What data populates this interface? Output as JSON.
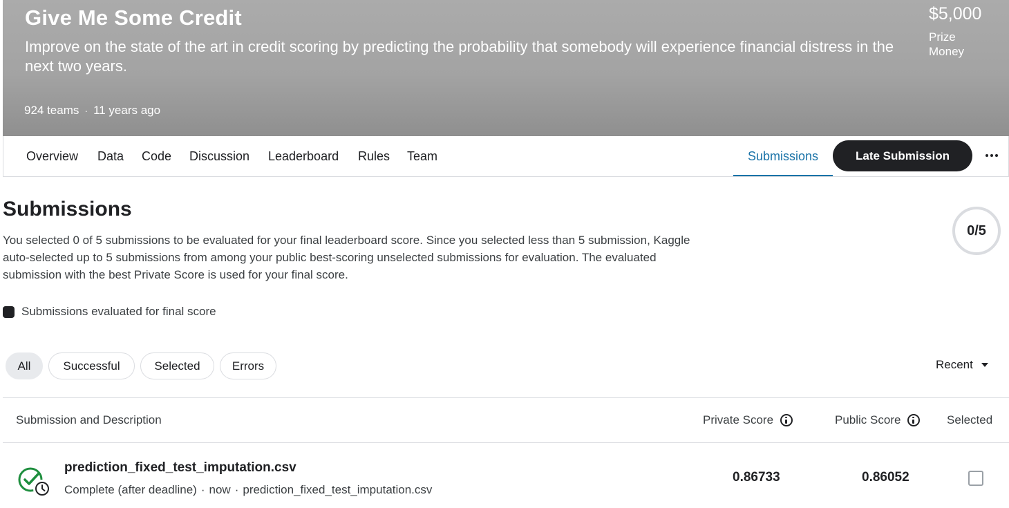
{
  "banner": {
    "title": "Give Me Some Credit",
    "description": "Improve on the state of the art in credit scoring by predicting the probability that somebody will experience financial distress in the next two years.",
    "teams": "924 teams",
    "separator": "·",
    "age": "11 years ago",
    "prize_amount": "$5,000",
    "prize_label": "Prize Money"
  },
  "nav": {
    "tabs": [
      "Overview",
      "Data",
      "Code",
      "Discussion",
      "Leaderboard",
      "Rules",
      "Team"
    ],
    "active_tab": "Submissions",
    "late_submission": "Late Submission",
    "more_icon": "more-horizontal-icon"
  },
  "submissions": {
    "title": "Submissions",
    "description": "You selected 0 of 5 submissions to be evaluated for your final leaderboard score. Since you selected less than 5 submission, Kaggle auto-selected up to 5 submissions from among your public best-scoring unselected submissions for evaluation. The evaluated submission with the best Private Score is used for your final score.",
    "selected_count": "0/5",
    "legend": "Submissions evaluated for final score",
    "filters": [
      "All",
      "Successful",
      "Selected",
      "Errors"
    ],
    "active_filter": "All",
    "sort": "Recent"
  },
  "table": {
    "headers": {
      "submission": "Submission and Description",
      "private": "Private Score",
      "public": "Public Score",
      "selected": "Selected"
    },
    "rows": [
      {
        "file": "prediction_fixed_test_imputation.csv",
        "status": "Complete (after deadline)",
        "time": "now",
        "description": "prediction_fixed_test_imputation.csv",
        "private_score": "0.86733",
        "public_score": "0.86052",
        "selected": false
      }
    ]
  },
  "colors": {
    "accent": "#1a73a8",
    "dark": "#202124",
    "success": "#1e8e3e"
  }
}
